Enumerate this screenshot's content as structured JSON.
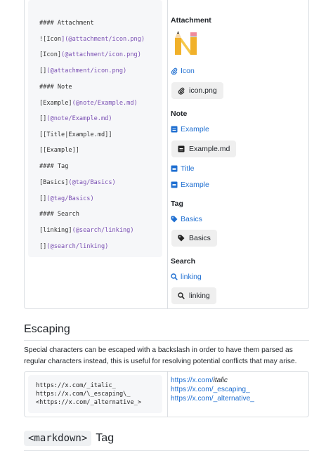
{
  "syntax_code": [
    {
      "parts": [
        {
          "t": "#### ",
          "c": "k"
        },
        {
          "t": "Attachment",
          "c": "k"
        }
      ]
    },
    {
      "parts": [
        {
          "t": "![",
          "c": "k"
        },
        {
          "t": "Icon",
          "c": "k"
        },
        {
          "t": "](@attachment/icon.png)",
          "c": "p"
        }
      ]
    },
    {
      "parts": [
        {
          "t": "[Icon]",
          "c": "k"
        },
        {
          "t": "(@attachment/icon.png)",
          "c": "p"
        }
      ]
    },
    {
      "parts": [
        {
          "t": "[]",
          "c": "k"
        },
        {
          "t": "(@attachment/icon.png)",
          "c": "p"
        }
      ]
    },
    {
      "parts": [
        {
          "t": "#### ",
          "c": "k"
        },
        {
          "t": "Note",
          "c": "k"
        }
      ]
    },
    {
      "parts": [
        {
          "t": "[Example]",
          "c": "k"
        },
        {
          "t": "(@note/Example.md)",
          "c": "p"
        }
      ]
    },
    {
      "parts": [
        {
          "t": "[]",
          "c": "k"
        },
        {
          "t": "(@note/Example.md)",
          "c": "p"
        }
      ]
    },
    {
      "parts": [
        {
          "t": "[[",
          "c": "k"
        },
        {
          "t": "Title|Example.md",
          "c": "k"
        },
        {
          "t": "]]",
          "c": "k"
        }
      ]
    },
    {
      "parts": [
        {
          "t": "[[",
          "c": "k"
        },
        {
          "t": "Example",
          "c": "k"
        },
        {
          "t": "]]",
          "c": "k"
        }
      ]
    },
    {
      "parts": [
        {
          "t": "#### ",
          "c": "k"
        },
        {
          "t": "Tag",
          "c": "k"
        }
      ]
    },
    {
      "parts": [
        {
          "t": "[Basics]",
          "c": "k"
        },
        {
          "t": "(@tag/Basics)",
          "c": "p"
        }
      ]
    },
    {
      "parts": [
        {
          "t": "[]",
          "c": "k"
        },
        {
          "t": "(@tag/Basics)",
          "c": "p"
        }
      ]
    },
    {
      "parts": [
        {
          "t": "#### ",
          "c": "k"
        },
        {
          "t": "Search",
          "c": "k"
        }
      ]
    },
    {
      "parts": [
        {
          "t": "[linking]",
          "c": "k"
        },
        {
          "t": "(@search/linking)",
          "c": "p"
        }
      ]
    },
    {
      "parts": [
        {
          "t": "[]",
          "c": "k"
        },
        {
          "t": "(@search/linking)",
          "c": "p"
        }
      ]
    }
  ],
  "preview": {
    "attachment": {
      "heading": "Attachment",
      "link_label": "Icon",
      "chip_label": "icon.png"
    },
    "note": {
      "heading": "Note",
      "link1": "Example",
      "chip_label": "Example.md",
      "link2": "Title",
      "link3": "Example"
    },
    "tag": {
      "heading": "Tag",
      "link_label": "Basics",
      "chip_label": "Basics"
    },
    "search": {
      "heading": "Search",
      "link_label": "linking",
      "chip_label": "linking"
    }
  },
  "escaping": {
    "heading": "Escaping",
    "paragraph": "Special characters can be escaped with a backslash in order to have them parsed as regular characters instead, this is useful for resolving potential conflicts that may arise.",
    "code_lines": [
      "https://x.com/_italic_",
      "https://x.com/\\_escaping\\_",
      "<https://x.com/_alternative_>"
    ],
    "rendered": {
      "line1_prefix": "https://x.com/",
      "line1_italic": "italic",
      "line2": "https://x.com/_escaping_",
      "line3": "https://x.com/_alternative_"
    }
  },
  "markdown_tag": {
    "code": "<markdown>",
    "word": "Tag"
  },
  "colors": {
    "link": "#1f6fd1",
    "code_purple": "#7a4fb3",
    "chip_bg": "#efefef"
  }
}
